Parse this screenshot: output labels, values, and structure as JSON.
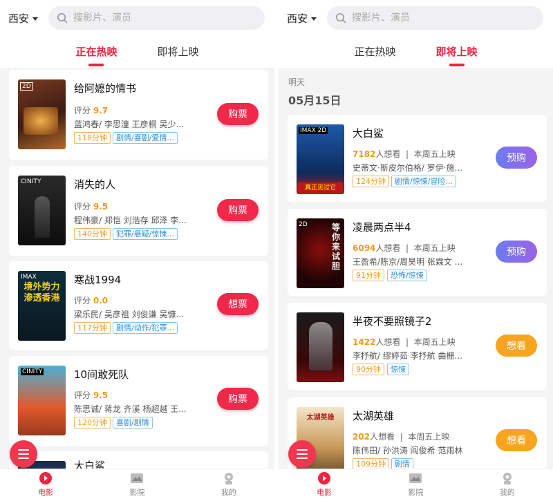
{
  "left": {
    "city": "西安",
    "search_placeholder": "搜影片、演员",
    "tabs": [
      "正在热映",
      "即将上映"
    ],
    "movies": [
      {
        "title": "给阿嬷的情书",
        "score_label": "评分",
        "score": "9.7",
        "actors": "蓝鸿春/ 李思潼 王彦桐 吴少...",
        "duration": "118分钟",
        "genres": "剧情/喜剧/爱情...",
        "button": "购票"
      },
      {
        "title": "消失的人",
        "score_label": "评分",
        "score": "9.5",
        "actors": "程伟豪/ 郑恺 刘浩存 邱泽 李...",
        "duration": "140分钟",
        "genres": "犯罪/悬疑/惊悚...",
        "button": "购票",
        "poster_label": "CINITY"
      },
      {
        "title": "寒战1994",
        "score_label": "评分",
        "score": "0.0",
        "actors": "梁乐民/ 吴彦祖 刘俊谦 吴慷...",
        "duration": "117分钟",
        "genres": "剧情/动作/犯罪...",
        "button": "想票",
        "poster_label": "IMAX",
        "poster_text": "境外势力渗透香港"
      },
      {
        "title": "10间敢死队",
        "score_label": "评分",
        "score": "9.5",
        "actors": "陈思诚/ 蒋龙 齐溪 杨超越 王...",
        "duration": "120分钟",
        "genres": "喜剧/剧情",
        "button": "购票",
        "poster_label": "CINITY"
      },
      {
        "title": "大白鲨"
      }
    ],
    "nav": [
      "电影",
      "影院",
      "我的"
    ]
  },
  "right": {
    "city": "西安",
    "search_placeholder": "搜影片、演员",
    "tabs": [
      "正在热映",
      "即将上映"
    ],
    "date_small": "明天",
    "date_big": "05月15日",
    "movies": [
      {
        "title": "大白鲨",
        "want": "7182",
        "want_label": "人想看",
        "release": "本周五上映",
        "actors": "史蒂文·斯皮尔伯格/ 罗伊·施...",
        "duration": "124分钟",
        "genres": "剧情/惊悚/冒险...",
        "button": "预购",
        "poster_label": "IMAX 2D",
        "poster_text": "真正见过它"
      },
      {
        "title": "凌晨两点半4",
        "want": "6094",
        "want_label": "人想看",
        "release": "本周五上映",
        "actors": "王盈希/陈京/周昊明 张霖文 ...",
        "duration": "91分钟",
        "genres": "恐怖/惊悚",
        "button": "预购",
        "poster_label": "2D",
        "poster_text": "等你来试胆"
      },
      {
        "title": "半夜不要照镜子2",
        "want": "1422",
        "want_label": "人想看",
        "release": "本周五上映",
        "actors": "李抒航/ 缪婷茹 李抒航 曲栅...",
        "duration": "90分钟",
        "genres": "惊悚",
        "button": "想看"
      },
      {
        "title": "太湖英雄",
        "want": "202",
        "want_label": "人想看",
        "release": "本周五上映",
        "actors": "陈伟田/ 孙洪涛 阎俊希 范雨林",
        "duration": "109分钟",
        "genres": "剧情",
        "button": "想看",
        "poster_text": "太湖英雄"
      }
    ],
    "nav": [
      "电影",
      "影院",
      "我的"
    ]
  },
  "colors": {
    "accent": "#f0233f",
    "score": "#f49a18",
    "tag_blue": "#2b8ed6",
    "presale_purple": "#7b74ee",
    "want_orange": "#f7a520"
  }
}
